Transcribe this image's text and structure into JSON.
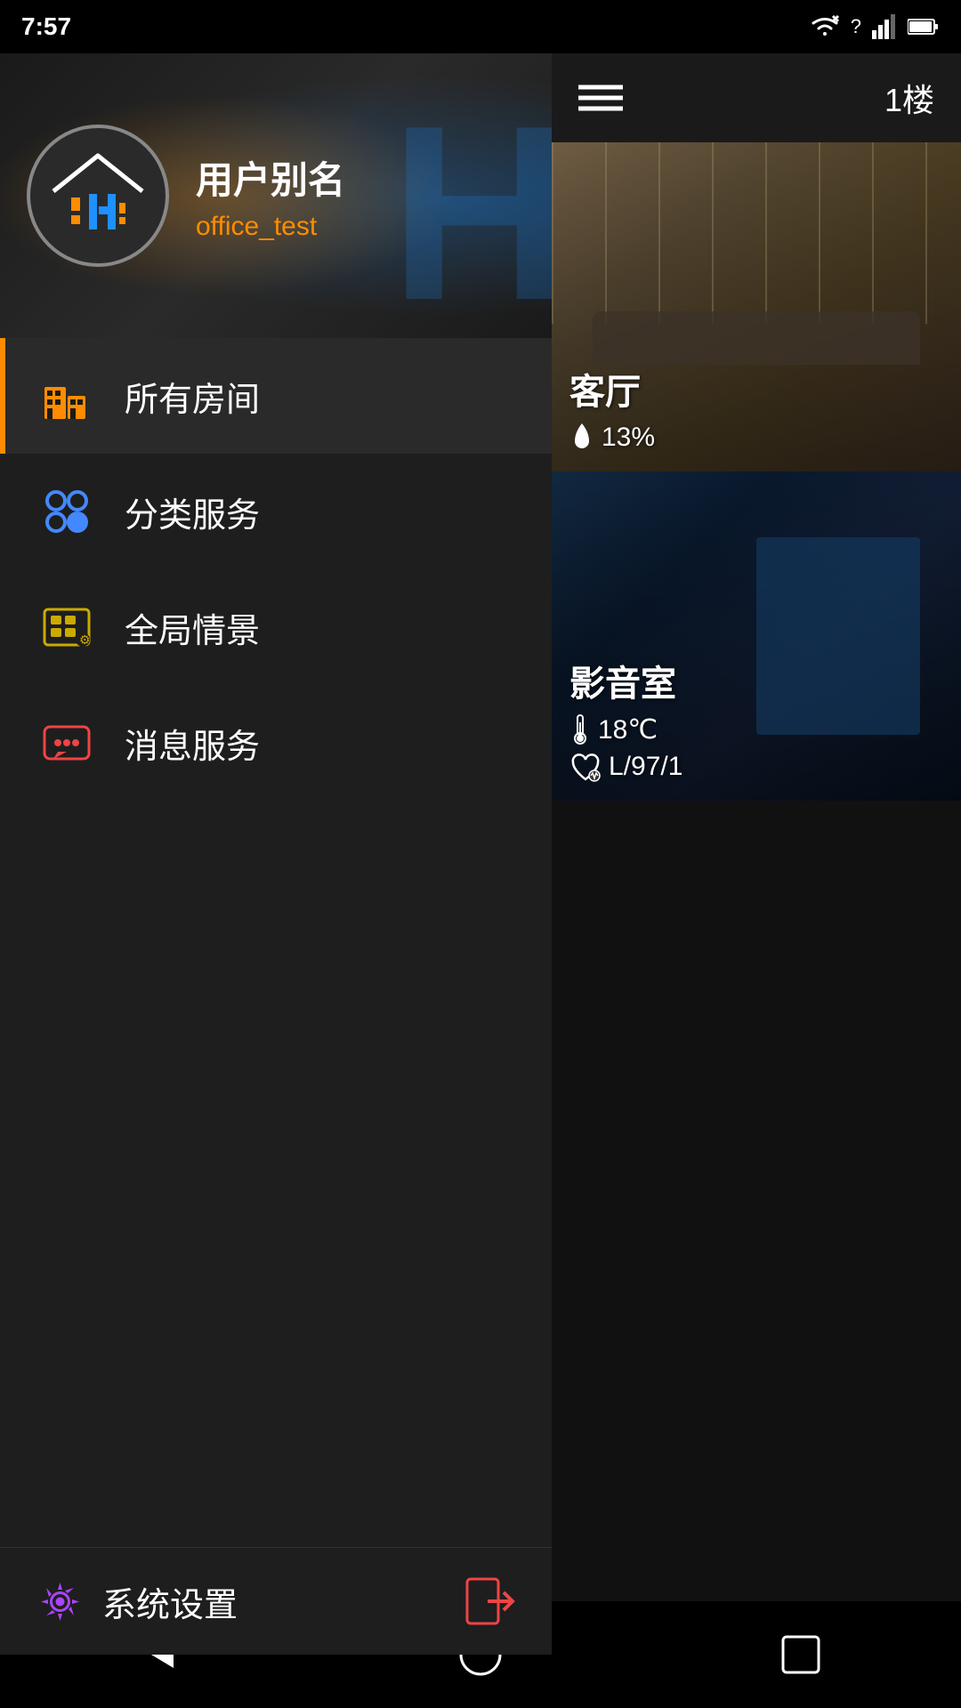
{
  "statusBar": {
    "time": "7:57",
    "wifiIcon": "wifi",
    "signalIcon": "signal",
    "batteryIcon": "battery"
  },
  "sidebar": {
    "userAlias": "用户别名",
    "userName": "office_test",
    "navItems": [
      {
        "id": "all-rooms",
        "label": "所有房间",
        "icon": "building",
        "active": true
      },
      {
        "id": "category",
        "label": "分类服务",
        "icon": "category",
        "active": false
      },
      {
        "id": "scene",
        "label": "全局情景",
        "icon": "scene",
        "active": false
      },
      {
        "id": "message",
        "label": "消息服务",
        "icon": "message",
        "active": false
      }
    ],
    "settingsLabel": "系统设置",
    "logoutIcon": "logout"
  },
  "rightPanel": {
    "menuIcon": "menu",
    "floorLabel": "1楼",
    "rooms": [
      {
        "id": "living-room",
        "name": "客厅",
        "theme": "living",
        "humidity": "13%",
        "humidityIcon": "drop"
      },
      {
        "id": "theater",
        "name": "影音室",
        "theme": "theater",
        "temperature": "18℃",
        "heartRate": "L/97/1",
        "tempIcon": "thermometer",
        "heartIcon": "heart"
      }
    ]
  },
  "navBar": {
    "backIcon": "back",
    "homeIcon": "home",
    "recentIcon": "recent"
  }
}
